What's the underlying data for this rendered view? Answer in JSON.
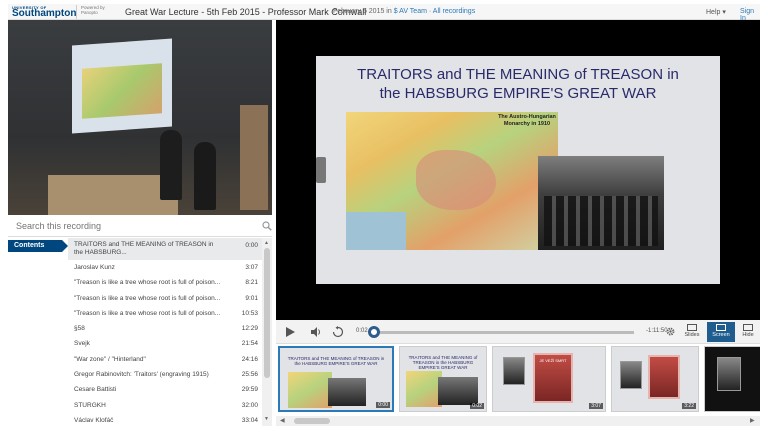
{
  "header": {
    "logo_small": "UNIVERSITY OF",
    "logo_name": "Southampton",
    "powered_by": "Powered by",
    "powered_brand": "Panopto",
    "title": "Great War Lecture - 5th Feb 2015 - Professor Mark Cornwall",
    "date_prefix": "February 5 2015 in",
    "folder_link": "$ AV Team",
    "separator": "·",
    "all_recordings": "All recordings",
    "help": "Help ▾",
    "sign_in": "Sign In"
  },
  "search": {
    "placeholder": "Search this recording",
    "icon": "search-icon"
  },
  "contents": {
    "tab_label": "Contents",
    "items": [
      {
        "label": "TRAITORS and THE MEANING of TREASON in the HABSBURG...",
        "time": "0:00"
      },
      {
        "label": "Jaroslav Kunz",
        "time": "3:07"
      },
      {
        "label": "\"Treason is like a tree whose root is full of poison...",
        "time": "8:21"
      },
      {
        "label": "\"Treason is like a tree whose root is full of poison...",
        "time": "9:01"
      },
      {
        "label": "\"Treason is like a tree whose root is full of poison...",
        "time": "10:53"
      },
      {
        "label": "§58",
        "time": "12:29"
      },
      {
        "label": "Švejk",
        "time": "21:54"
      },
      {
        "label": "\"War zone\" / \"Hinterland\"",
        "time": "24:16"
      },
      {
        "label": "Gregor Rabinovitch: 'Traitors' (engraving 1915)",
        "time": "25:56"
      },
      {
        "label": "Cesare Battisti",
        "time": "29:59"
      },
      {
        "label": "STÜRGKH",
        "time": "32:00"
      },
      {
        "label": "Václav Klofáč",
        "time": "33:04"
      }
    ]
  },
  "slide": {
    "title_line1": "TRAITORS and THE MEANING of TREASON in",
    "title_line2": "the HABSBURG EMPIRE'S GREAT WAR",
    "map_label": "The Austro-Hungarian Monarchy in 1910"
  },
  "controls": {
    "current_time": "0:02",
    "remaining_time": "-1:11:50",
    "progress": 0.001,
    "slides_label": "Slides",
    "screen_label": "Screen",
    "hide_label": "Hide"
  },
  "thumbnails": [
    {
      "title": "TRAITORS and THE MEANING of TREASON in the HABSBURG EMPIRE'S GREAT WAR",
      "time": "0:00"
    },
    {
      "title": "TRAITORS and THE MEANING of TREASON in the HABSBURG EMPIRE'S GREAT WAR",
      "time": "0:02"
    },
    {
      "title": "",
      "time": "3:07"
    },
    {
      "title": "",
      "time": "3:22"
    },
    {
      "title": "",
      "time": ""
    }
  ],
  "book_text": "JE VEŽÍ SMRT"
}
